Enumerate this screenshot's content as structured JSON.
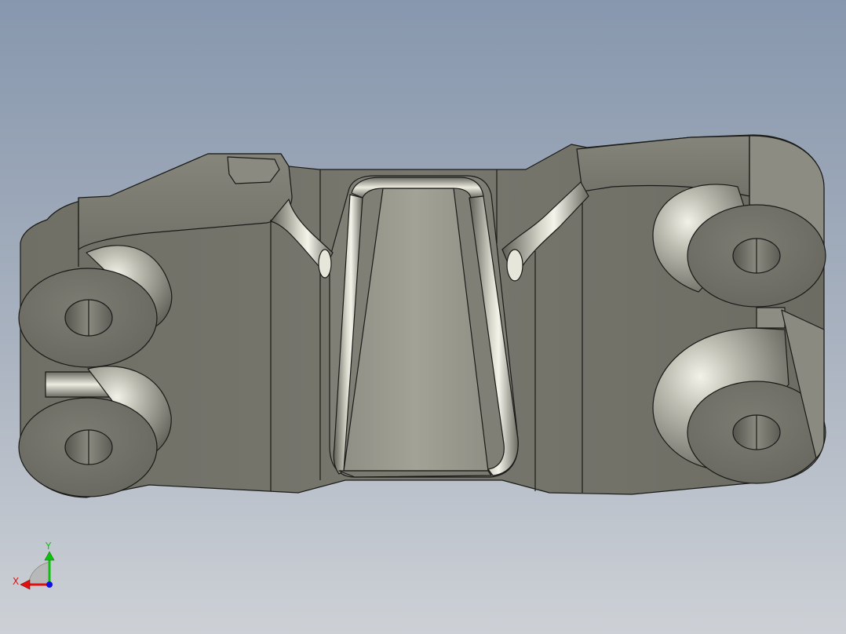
{
  "viewport": {
    "background_top": "#8797ad",
    "background_bottom": "#c9ced4",
    "part_color": "#7d7d73"
  },
  "triad": {
    "x_label": "X",
    "y_label": "Y",
    "x_color": "#e01010",
    "y_color": "#10c010",
    "z_color": "#1010e0"
  }
}
